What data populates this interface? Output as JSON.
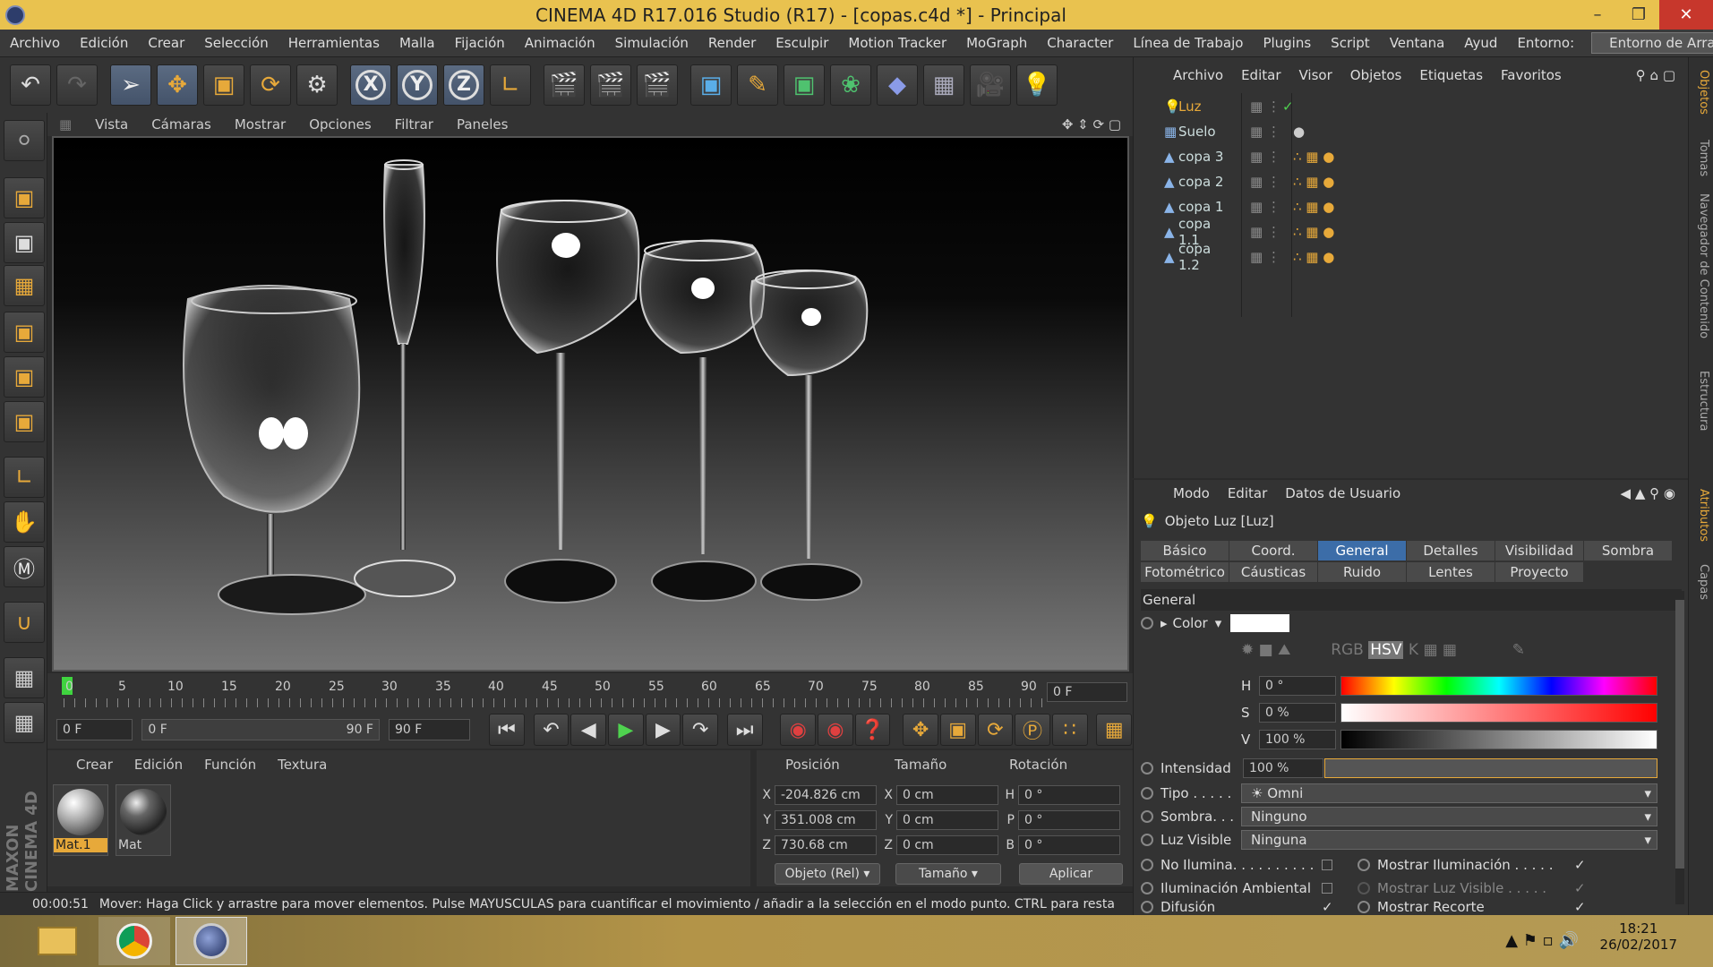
{
  "window": {
    "title": "CINEMA 4D R17.016 Studio (R17) - [copas.c4d *] - Principal"
  },
  "menubar": {
    "items": [
      "Archivo",
      "Edición",
      "Crear",
      "Selección",
      "Herramientas",
      "Malla",
      "Fijación",
      "Animación",
      "Simulación",
      "Render",
      "Esculpir",
      "Motion Tracker",
      "MoGraph",
      "Character",
      "Línea de Trabajo",
      "Plugins",
      "Script",
      "Ventana",
      "Ayud"
    ],
    "env_label": "Entorno:",
    "env_value": "Entorno de Arranque"
  },
  "viewport_menu": [
    "Vista",
    "Cámaras",
    "Mostrar",
    "Opciones",
    "Filtrar",
    "Paneles"
  ],
  "timeline": {
    "ticks": [
      "0",
      "5",
      "10",
      "15",
      "20",
      "25",
      "30",
      "35",
      "40",
      "45",
      "50",
      "55",
      "60",
      "65",
      "70",
      "75",
      "80",
      "85",
      "90"
    ],
    "current_frame": "0 F"
  },
  "transport": {
    "start": "0 F",
    "range_start": "0 F",
    "range_end": "90 F",
    "end": "90 F"
  },
  "material_manager": {
    "menu": [
      "Crear",
      "Edición",
      "Función",
      "Textura"
    ],
    "materials": [
      {
        "name": "Mat.1"
      },
      {
        "name": "Mat"
      }
    ]
  },
  "coordinates": {
    "headers": [
      "Posición",
      "Tamaño",
      "Rotación"
    ],
    "rows": [
      {
        "axis": "X",
        "pos": "-204.826 cm",
        "size_axis": "X",
        "size": "0 cm",
        "rot_axis": "H",
        "rot": "0 °"
      },
      {
        "axis": "Y",
        "pos": "351.008 cm",
        "size_axis": "Y",
        "size": "0 cm",
        "rot_axis": "P",
        "rot": "0 °"
      },
      {
        "axis": "Z",
        "pos": "730.68 cm",
        "size_axis": "Z",
        "size": "0 cm",
        "rot_axis": "B",
        "rot": "0 °"
      }
    ],
    "mode": "Objeto (Rel)",
    "size_mode": "Tamaño",
    "apply": "Aplicar"
  },
  "status": {
    "time": "00:00:51",
    "message": "Mover: Haga Click y arrastre para mover elementos. Pulse MAYUSCULAS para cuantificar el movimiento / añadir a la selección en el modo punto. CTRL para resta"
  },
  "object_manager": {
    "menu": [
      "Archivo",
      "Editar",
      "Visor",
      "Objetos",
      "Etiquetas",
      "Favoritos"
    ],
    "objects": [
      "Luz",
      "Suelo",
      "copa 3",
      "copa 2",
      "copa 1",
      "copa 1.1",
      "copa 1.2"
    ]
  },
  "attributes": {
    "menu": [
      "Modo",
      "Editar",
      "Datos de Usuario"
    ],
    "object_title": "Objeto Luz [Luz]",
    "tabs_row1": [
      "Básico",
      "Coord.",
      "General",
      "Detalles",
      "Visibilidad",
      "Sombra"
    ],
    "tabs_row2": [
      "Fotométrico",
      "Cáusticas",
      "Ruido",
      "Lentes",
      "Proyecto"
    ],
    "section": "General",
    "color_label": "Color",
    "h_label": "H",
    "h_value": "0 °",
    "s_label": "S",
    "s_value": "0 %",
    "v_label": "V",
    "v_value": "100 %",
    "intensity_label": "Intensidad",
    "intensity_value": "100 %",
    "type_label": "Tipo . . . . .",
    "type_value": "Omni",
    "shadow_label": "Sombra. . .",
    "shadow_value": "Ninguno",
    "visible_label": "Luz Visible",
    "visible_value": "Ninguna",
    "no_illum": "No Ilumina. . . . . . . . . .",
    "show_illum": "Mostrar Iluminación . . . . .",
    "ambient": "Iluminación Ambiental",
    "show_visible": "Mostrar Luz Visible . . . . .",
    "diffusion": "Difusión",
    "show_clip": "Mostrar Recorte"
  },
  "sidebar": [
    "Objetos",
    "Tomas",
    "Navegador de Contenido",
    "Estructura",
    "Atributos",
    "Capas"
  ],
  "taskbar": {
    "time": "18:21",
    "date": "26/02/2017"
  }
}
